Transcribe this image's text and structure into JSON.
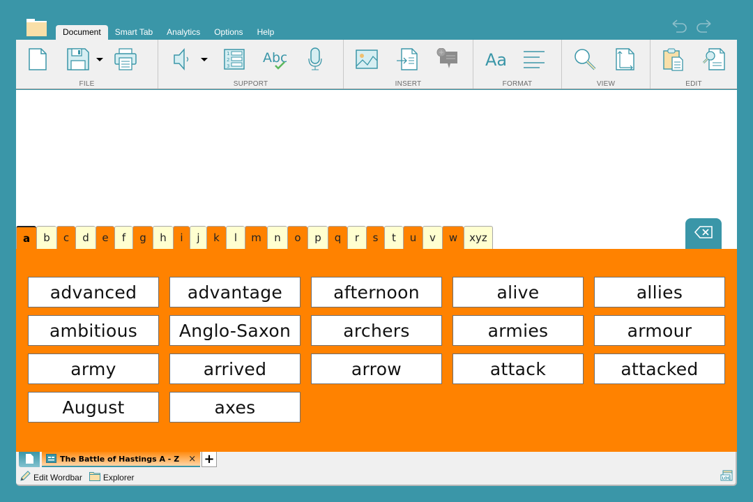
{
  "menu": {
    "tabs": [
      {
        "label": "Document",
        "active": true
      },
      {
        "label": "Smart Tab",
        "active": false
      },
      {
        "label": "Analytics",
        "active": false
      },
      {
        "label": "Options",
        "active": false
      },
      {
        "label": "Help",
        "active": false
      }
    ]
  },
  "titlebar": {
    "undo_icon": "undo-icon",
    "redo_icon": "redo-icon"
  },
  "ribbon": {
    "groups": [
      {
        "label": "FILE",
        "items": [
          "new-document-icon",
          "save-icon",
          "save-dropdown",
          "print-icon"
        ]
      },
      {
        "label": "SUPPORT",
        "items": [
          "speaker-icon",
          "speech-dropdown",
          "numbered-list-icon",
          "spellcheck-icon",
          "microphone-icon"
        ]
      },
      {
        "label": "INSERT",
        "items": [
          "insert-image-icon",
          "insert-file-icon",
          "add-comment-icon"
        ]
      },
      {
        "label": "FORMAT",
        "items": [
          "font-icon",
          "paragraph-align-icon"
        ]
      },
      {
        "label": "VIEW",
        "items": [
          "zoom-icon",
          "page-size-icon"
        ]
      },
      {
        "label": "EDIT",
        "items": [
          "paste-icon",
          "find-icon"
        ]
      }
    ]
  },
  "letter_tabs": [
    "a",
    "b",
    "c",
    "d",
    "e",
    "f",
    "g",
    "h",
    "i",
    "j",
    "k",
    "l",
    "m",
    "n",
    "o",
    "p",
    "q",
    "r",
    "s",
    "t",
    "u",
    "v",
    "w",
    "xyz"
  ],
  "active_letter": "a",
  "words": [
    "advanced",
    "advantage",
    "afternoon",
    "alive",
    "allies",
    "ambitious",
    "Anglo-Saxon",
    "archers",
    "armies",
    "armour",
    "army",
    "arrived",
    "arrow",
    "attack",
    "attacked",
    "August",
    "axes"
  ],
  "colors": {
    "accent": "#3a96a8",
    "panel_orange": "#ff8200",
    "tab_light": "#ffffd0"
  },
  "wordbar": {
    "doc_tab_title": "The Battle of Hastings A - Z",
    "close_label": "×",
    "add_label": "+"
  },
  "status": {
    "edit_wordbar": "Edit Wordbar",
    "explorer": "Explorer"
  }
}
